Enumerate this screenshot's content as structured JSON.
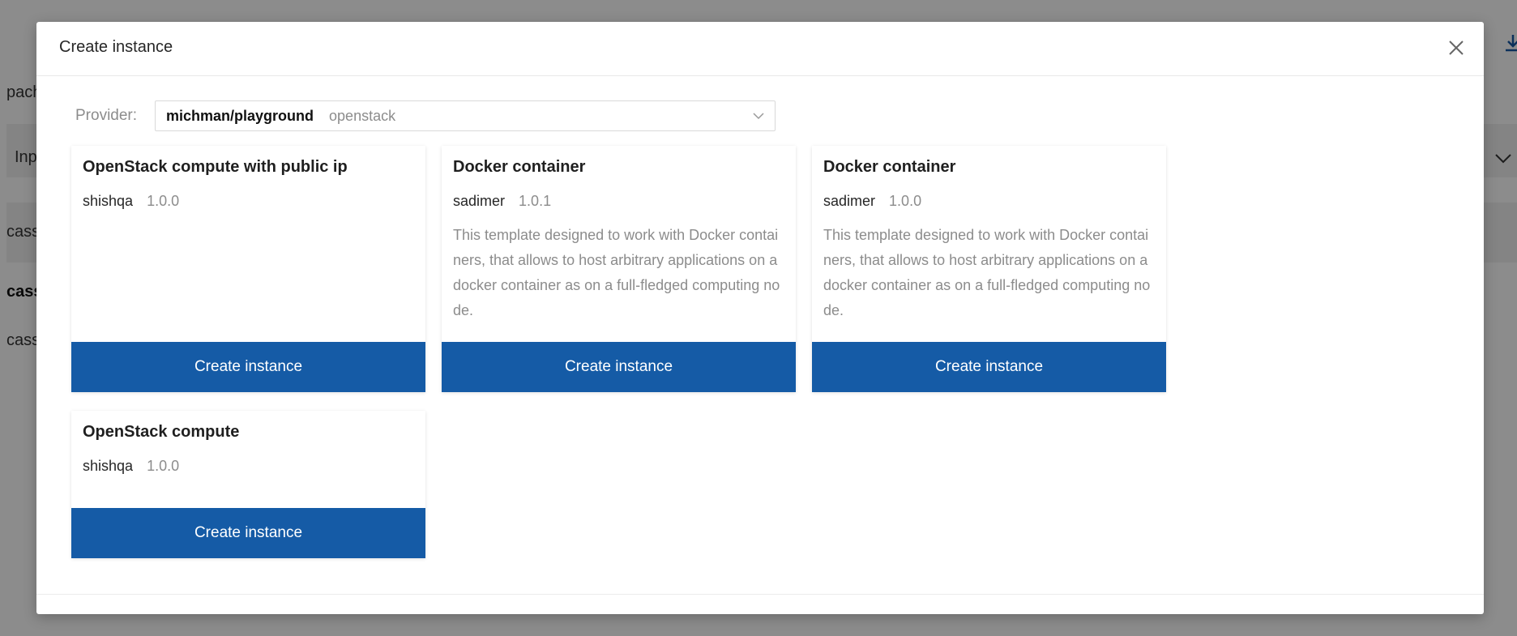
{
  "background": {
    "texts": [
      "pach",
      "Inp",
      "cass",
      "cass",
      "cass"
    ],
    "download_icon": "download-icon",
    "chevron_icon": "chevron-down-icon"
  },
  "modal": {
    "title": "Create instance",
    "close_icon": "close-icon",
    "provider": {
      "label": "Provider:",
      "name": "michman/playground",
      "type": "openstack"
    },
    "cards": [
      {
        "title": "OpenStack compute with public ip",
        "author": "shishqa",
        "version": "1.0.0",
        "description": "",
        "button": "Create instance"
      },
      {
        "title": "Docker container",
        "author": "sadimer",
        "version": "1.0.1",
        "description": "This template designed to work with Docker containers, that allows to host arbitrary applications on a docker container as on a full-fledged computing node.",
        "button": "Create instance"
      },
      {
        "title": "Docker container",
        "author": "sadimer",
        "version": "1.0.0",
        "description": "This template designed to work with Docker containers, that allows to host arbitrary applications on a docker container as on a full-fledged computing node.",
        "button": "Create instance"
      },
      {
        "title": "OpenStack compute",
        "author": "shishqa",
        "version": "1.0.0",
        "description": "",
        "button": "Create instance"
      }
    ]
  },
  "colors": {
    "primary": "#155ba6",
    "overlay": "rgba(0,0,0,0.45)"
  }
}
